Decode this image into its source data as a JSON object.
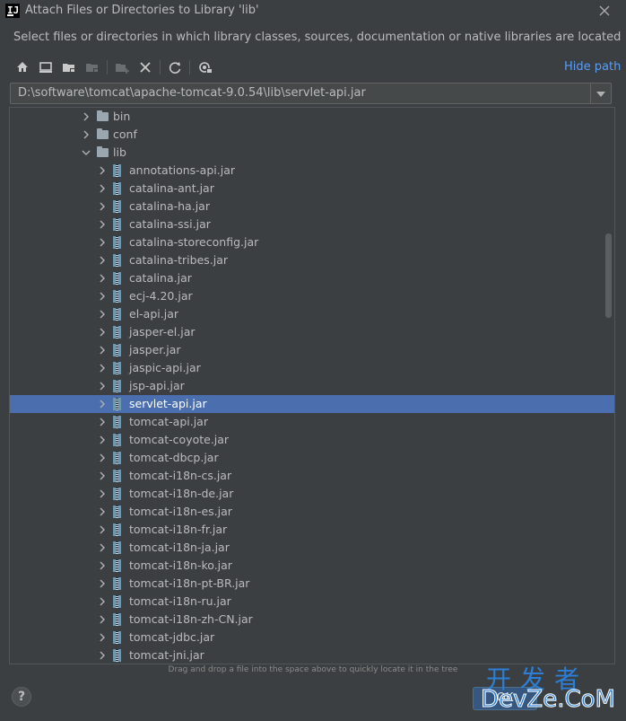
{
  "window": {
    "title": "Attach Files or Directories to Library 'lib'",
    "logo_text": "IJ"
  },
  "subtitle": "Select files or directories in which library classes, sources, documentation or native libraries are located",
  "toolbar": {
    "buttons": [
      "home-icon",
      "desktop-icon",
      "project-folder-icon",
      "module-folder-icon",
      "new-folder-icon",
      "delete-icon",
      "refresh-icon",
      "show-hidden-icon"
    ],
    "hide_path_label": "Hide path"
  },
  "path": {
    "value": "D:\\software\\tomcat\\apache-tomcat-9.0.54\\lib\\servlet-api.jar"
  },
  "tree": {
    "folders": [
      "bin",
      "conf",
      "lib"
    ],
    "jars": [
      "annotations-api.jar",
      "catalina-ant.jar",
      "catalina-ha.jar",
      "catalina-ssi.jar",
      "catalina-storeconfig.jar",
      "catalina-tribes.jar",
      "catalina.jar",
      "ecj-4.20.jar",
      "el-api.jar",
      "jasper-el.jar",
      "jasper.jar",
      "jaspic-api.jar",
      "jsp-api.jar",
      "servlet-api.jar",
      "tomcat-api.jar",
      "tomcat-coyote.jar",
      "tomcat-dbcp.jar",
      "tomcat-i18n-cs.jar",
      "tomcat-i18n-de.jar",
      "tomcat-i18n-es.jar",
      "tomcat-i18n-fr.jar",
      "tomcat-i18n-ja.jar",
      "tomcat-i18n-ko.jar",
      "tomcat-i18n-pt-BR.jar",
      "tomcat-i18n-ru.jar",
      "tomcat-i18n-zh-CN.jar",
      "tomcat-jdbc.jar",
      "tomcat-jni.jar"
    ],
    "selected": "servlet-api.jar"
  },
  "hint": "Drag and drop a file into the space above to quickly locate it in the tree",
  "footer": {
    "help_label": "?",
    "ok_label": "OK"
  },
  "watermark": {
    "text": "开发者",
    "site": "DevZe.CoM"
  }
}
